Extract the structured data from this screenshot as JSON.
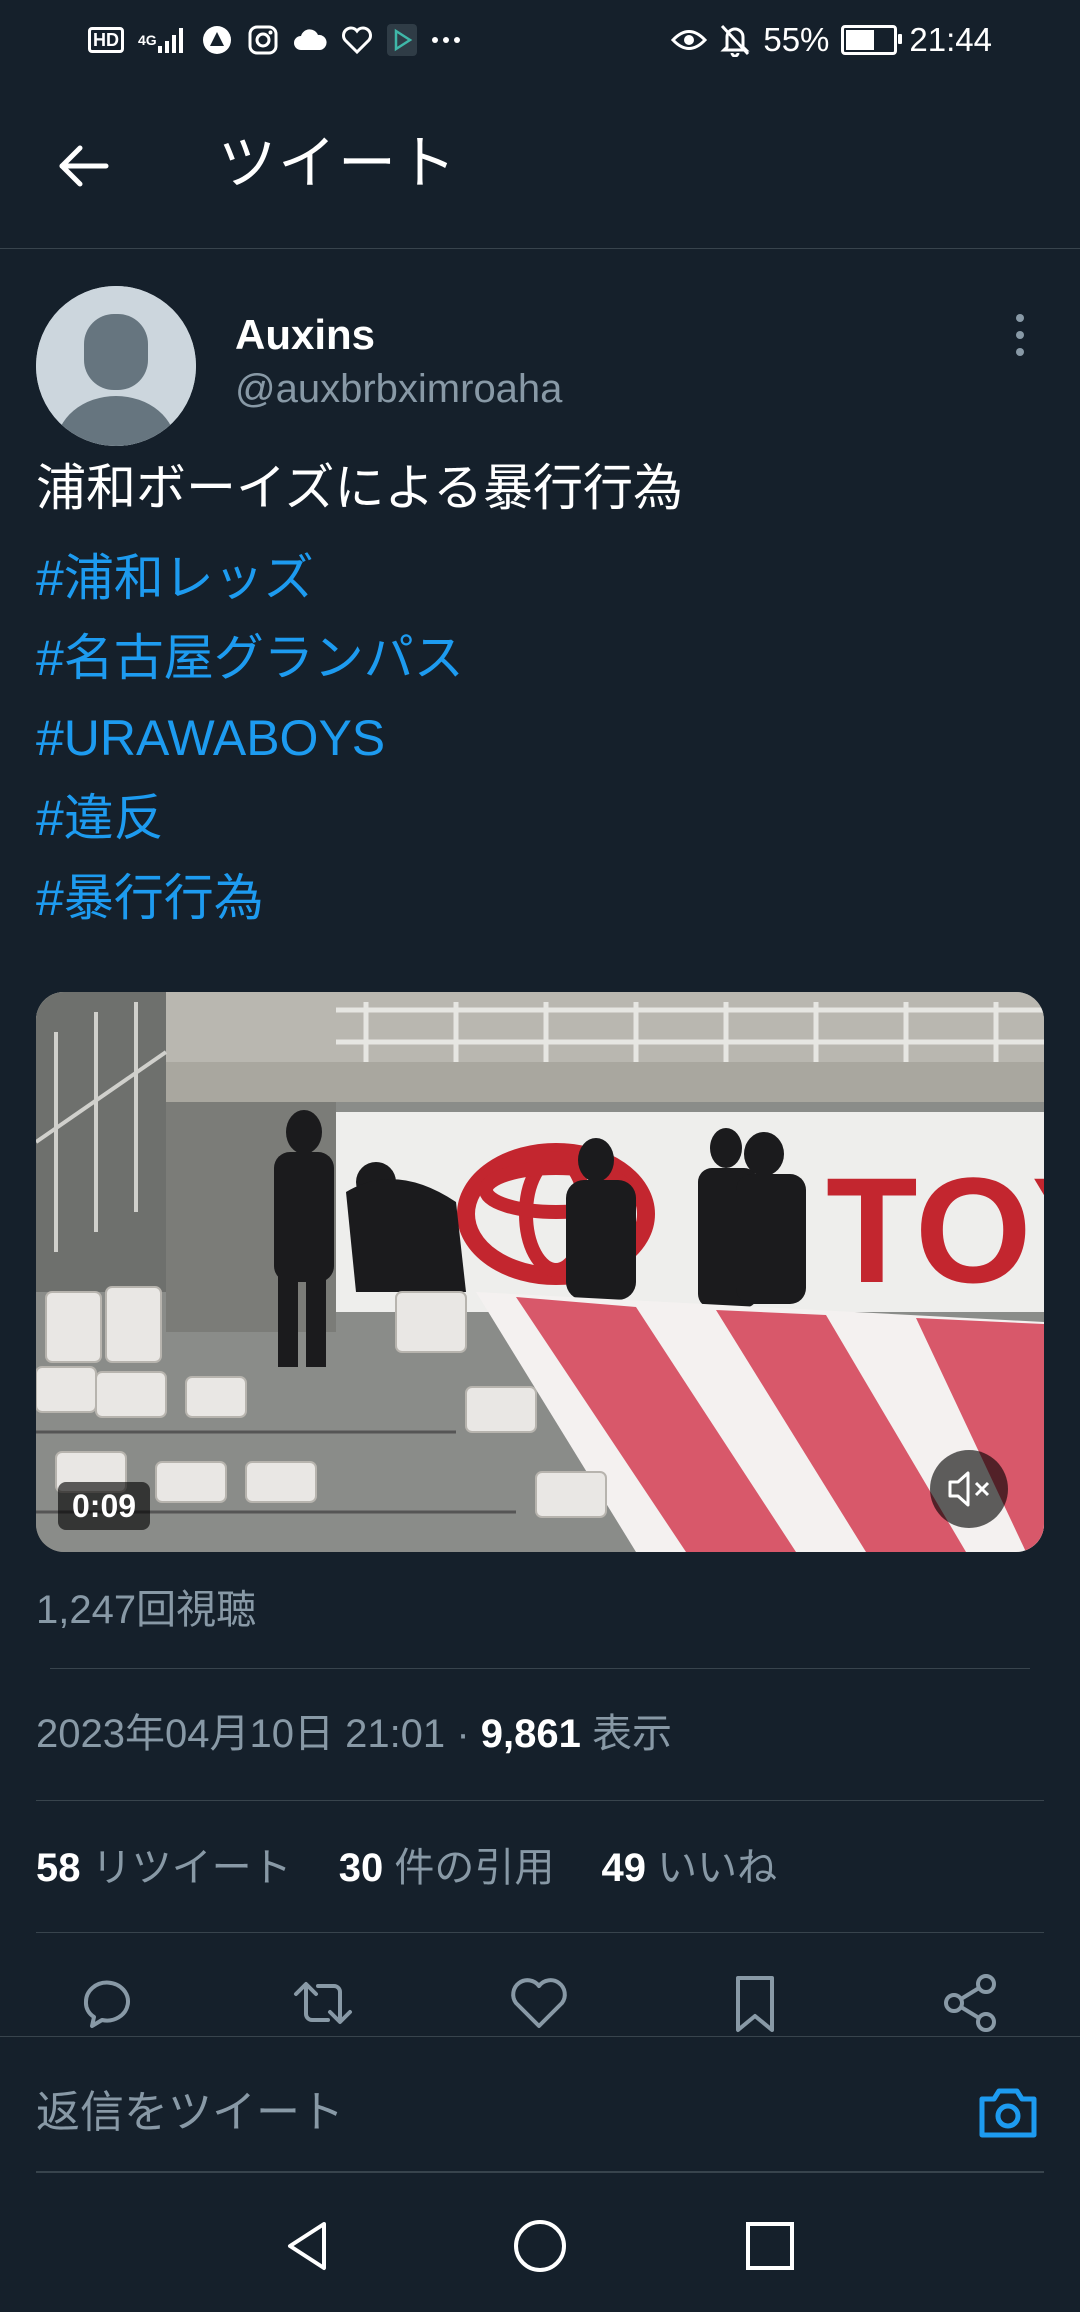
{
  "status_bar": {
    "network": "4G",
    "hd_label": "HD",
    "battery_percent": "55%",
    "battery_level": 0.55,
    "time": "21:44",
    "notification_icons": [
      "signal-icon",
      "app-icon",
      "instagram-icon",
      "cloud-icon",
      "heart-icon",
      "play-store-icon",
      "more-dots-icon"
    ],
    "right_icons": [
      "eye-icon",
      "bell-off-icon",
      "battery-icon"
    ]
  },
  "app_bar": {
    "title": "ツイート",
    "back_icon": "arrow-left-icon"
  },
  "tweet": {
    "display_name": "Auxins",
    "handle": "@auxbrbximroaha",
    "text": "浦和ボーイズによる暴行行為",
    "hashtags": [
      "#浦和レッズ",
      "#名古屋グランパス",
      "#URAWABOYS",
      "#違反",
      "#暴行行為"
    ],
    "media": {
      "duration": "0:09",
      "banner_text": "TOY",
      "muted": true
    },
    "view_count_label": "1,247回視聴",
    "timestamp": "2023年04月10日 21:01",
    "separator": "·",
    "impressions": "9,861",
    "impressions_label": "表示",
    "retweets": "58",
    "retweets_label": "リツイート",
    "quotes": "30",
    "quotes_label": "件の引用",
    "likes": "49",
    "likes_label": "いいね"
  },
  "actions": [
    "reply-icon",
    "retweet-icon",
    "like-icon",
    "bookmark-icon",
    "share-icon"
  ],
  "reply_bar": {
    "placeholder": "返信をツイート"
  },
  "colors": {
    "background": "#15202b",
    "accent": "#1d9bf0",
    "secondary_text": "#8899a6",
    "border": "#38444d"
  }
}
